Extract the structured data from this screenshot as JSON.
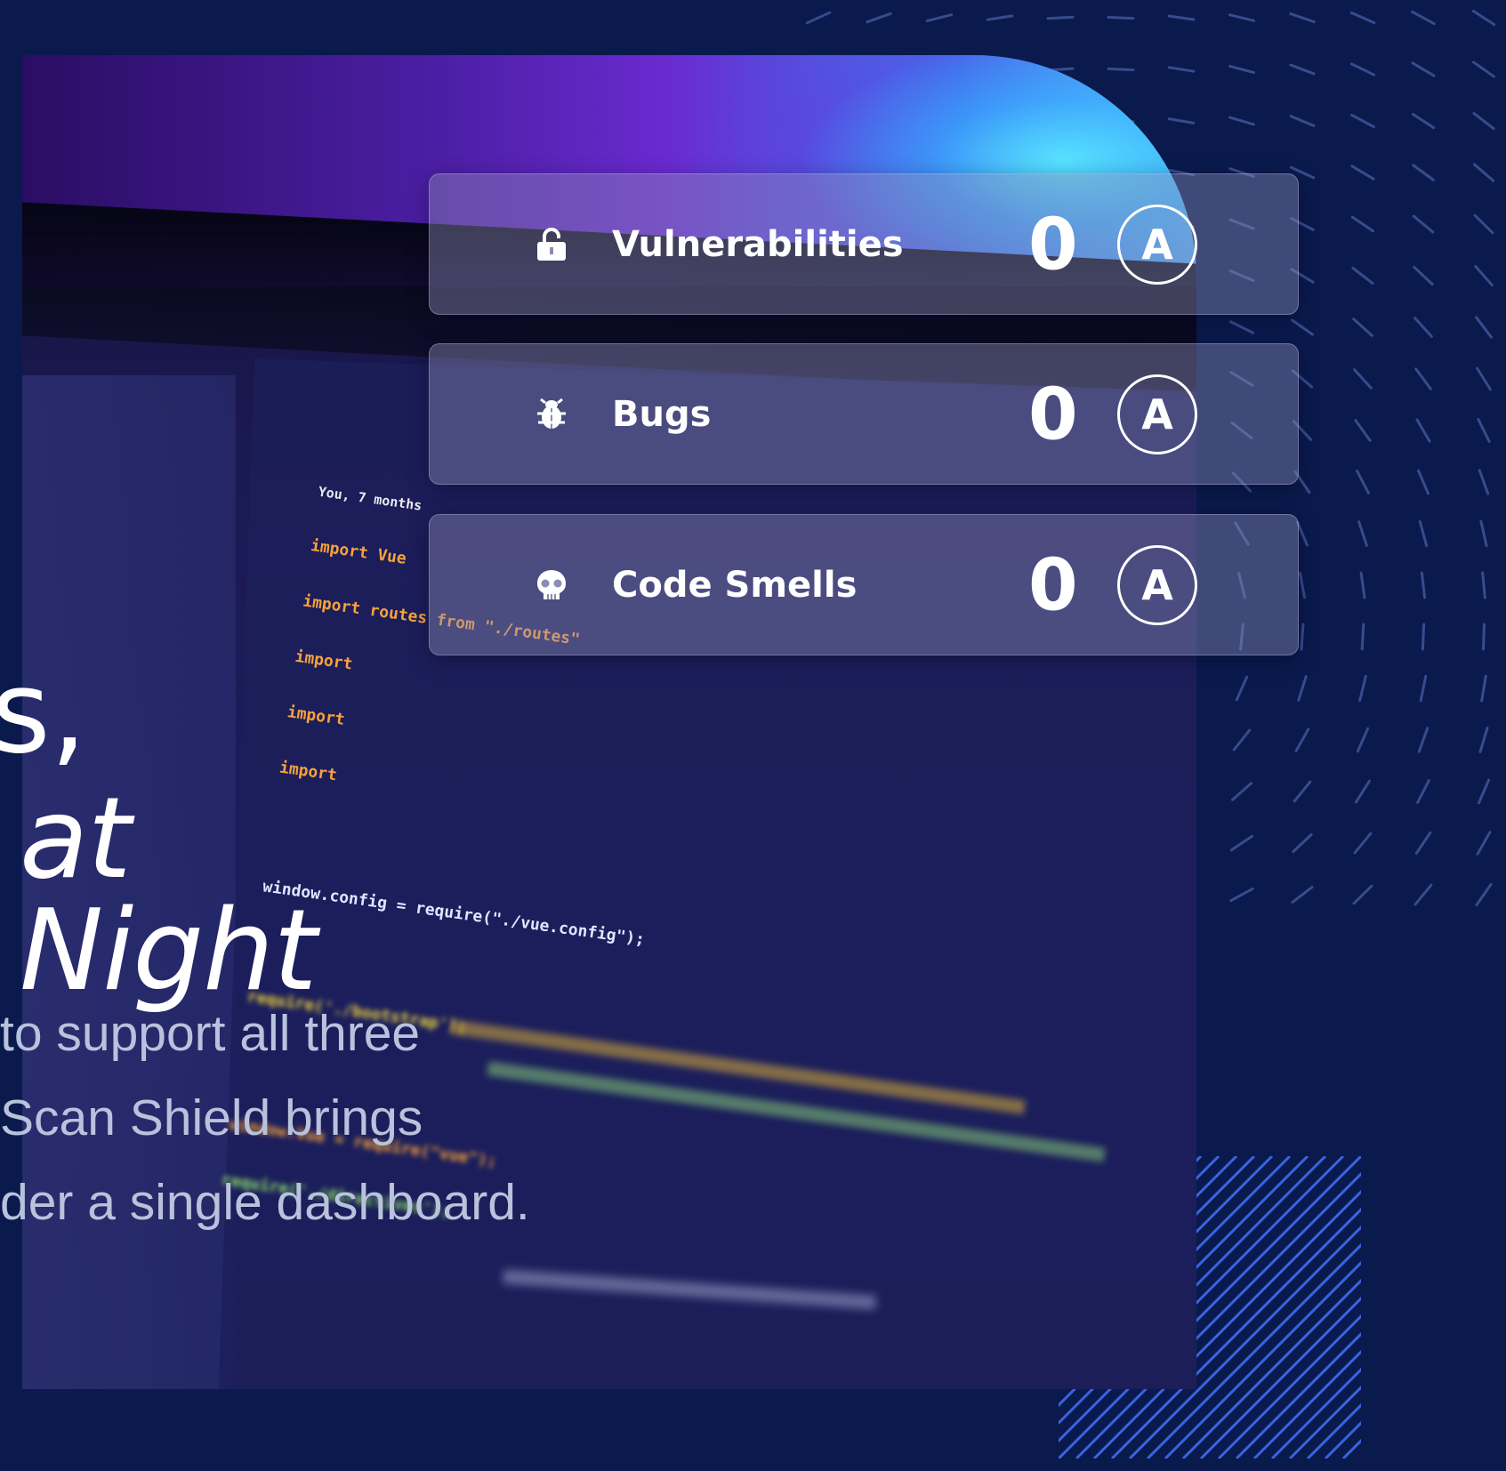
{
  "hero": {
    "headline_fragment_1": "s,",
    "headline_fragment_2": "at Night",
    "paragraph_lines": [
      "to support all three",
      "Scan Shield brings",
      "der a single dashboard."
    ]
  },
  "metrics": [
    {
      "icon": "lock-icon",
      "label": "Vulnerabilities",
      "value": "0",
      "grade": "A"
    },
    {
      "icon": "bug-icon",
      "label": "Bugs",
      "value": "0",
      "grade": "A"
    },
    {
      "icon": "skull-icon",
      "label": "Code Smells",
      "value": "0",
      "grade": "A"
    }
  ],
  "code_snippet_lines": [
    "import Vue",
    "import routes from \"./routes\"",
    "import",
    "import",
    "import",
    "window.config = require(\"./vue.config\");",
    "require('./bootstrap');",
    "window.Vue = require(\"vue\");",
    "require('./directives');"
  ],
  "colors": {
    "background": "#0a1a4c",
    "card_bg": "rgba(140,140,180,0.42)",
    "text_white": "#ffffff",
    "paragraph": "#b9c2dc",
    "accent_cyan": "#4fd8ff",
    "accent_purple": "#6a2ad0"
  }
}
